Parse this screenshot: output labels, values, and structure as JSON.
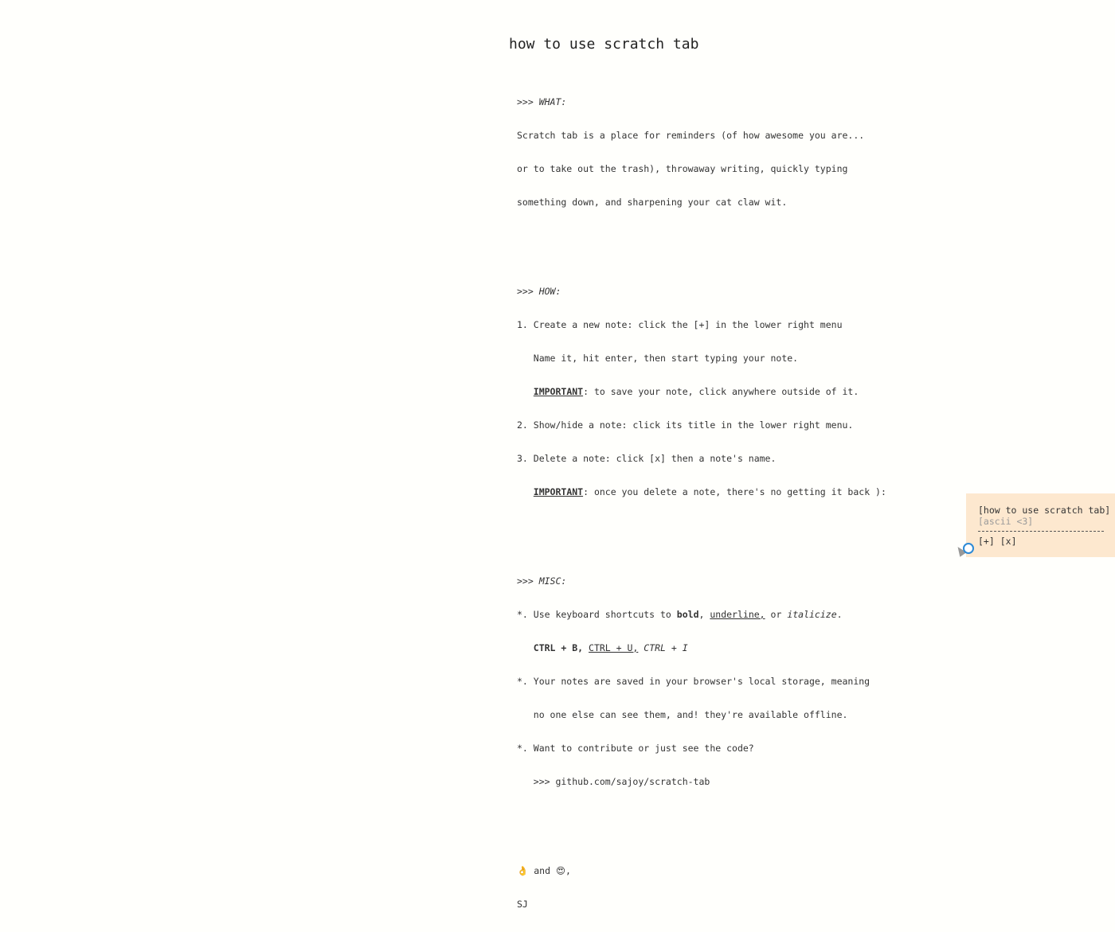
{
  "note": {
    "title": "how to use scratch tab",
    "what_head": ">>> WHAT:",
    "what_lines": [
      "Scratch tab is a place for reminders (of how awesome you are...",
      "or to take out the trash), throwaway writing, quickly typing",
      "something down, and sharpening your cat claw wit."
    ],
    "how_head": ">>> HOW:",
    "how_1a": "1. Create a new note: click the [+] in the lower right menu",
    "how_1b": "   Name it, hit enter, then start typing your note.",
    "important_label": "IMPORTANT",
    "how_1c_rest": ": to save your note, click anywhere outside of it.",
    "how_2": "2. Show/hide a note: click its title in the lower right menu.",
    "how_3a": "3. Delete a note: click [x] then a note's name.",
    "how_3b_rest": ": once you delete a note, there's no getting it back ):",
    "misc_head": ">>> MISC:",
    "misc_1_prefix": "*. Use keyboard shortcuts to ",
    "misc_1_bold": "bold",
    "misc_1_sep1": ", ",
    "misc_1_underline": "underline,",
    "misc_1_sep2": " or ",
    "misc_1_italic": "italicize",
    "misc_1_end": ".",
    "misc_shortcut_bold": "CTRL + B,",
    "misc_shortcut_underline": "CTRL + U,",
    "misc_shortcut_italic": "CTRL + I",
    "misc_2a": "*. Your notes are saved in your browser's local storage, meaning",
    "misc_2b": "   no one else can see them, and! they're available offline.",
    "misc_3a": "*. Want to contribute or just see the code?",
    "misc_3b": "   >>> github.com/sajoy/scratch-tab",
    "signoff_emoji_1": "👌",
    "signoff_and": " and ",
    "signoff_emoji_2": "😍",
    "signoff_comma": ",",
    "signature": "SJ"
  },
  "menu": {
    "items": [
      "[how to use scratch tab]",
      "[ascii <3]"
    ],
    "add_label": "[+]",
    "delete_label": "[x]"
  }
}
